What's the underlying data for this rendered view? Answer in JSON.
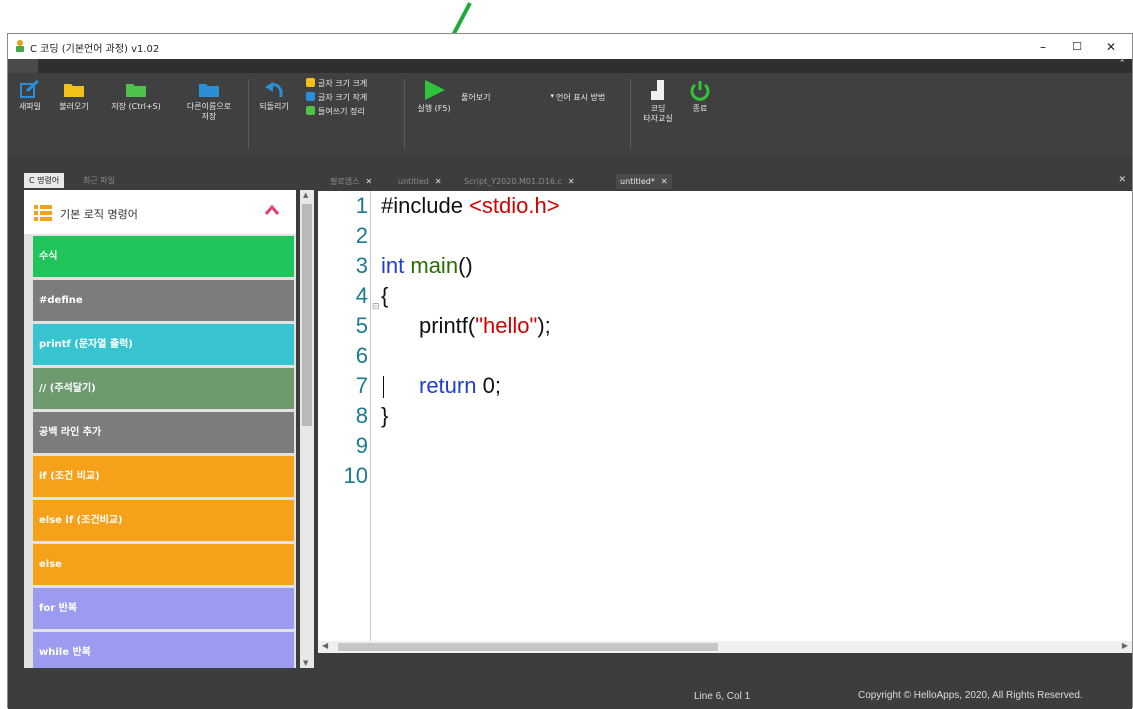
{
  "window": {
    "title": "C 코딩 (기본언어 과정) v1.02"
  },
  "toolbar": {
    "new_file": "새파일",
    "open": "불러오기",
    "save": "저장 (Ctrl+S)",
    "save_as_line1": "다른이름으로",
    "save_as_line2": "저장",
    "undo": "되돌리기",
    "font_bigger": "글자 크기 크게",
    "font_smaller": "글자 크기 작게",
    "indent_cleanup": "들여쓰기 정리",
    "run": "실행 (F5)",
    "view_select": "풀어보기",
    "lang_display": "언어 표시 방법",
    "typing_line1": "코딩",
    "typing_line2": "타자교실",
    "exit": "종료"
  },
  "left_panel": {
    "tabs": [
      "C 명령어",
      "최근 파일"
    ],
    "header": "기본 로직 명령어",
    "items": [
      {
        "label": "수식",
        "color": "#1fc55a"
      },
      {
        "label": "#define",
        "color": "#7c7c7c"
      },
      {
        "label": "printf (문자열 출력)",
        "color": "#38c3d0"
      },
      {
        "label": "// (주석달기)",
        "color": "#6e9a70"
      },
      {
        "label": "공백 라인 추가",
        "color": "#7c7c7c"
      },
      {
        "label": "if (조건 비교)",
        "color": "#f6a11a"
      },
      {
        "label": "else if (조건비교)",
        "color": "#f6a11a"
      },
      {
        "label": "else",
        "color": "#f6a11a"
      },
      {
        "label": "for 반복",
        "color": "#9b9cf0"
      },
      {
        "label": "while 반복",
        "color": "#9b9cf0"
      }
    ]
  },
  "editor": {
    "tabs": [
      {
        "label": "필로앱스",
        "active": false
      },
      {
        "label": "untitled",
        "active": false
      },
      {
        "label": "Script_Y2020.M01.D16.c",
        "active": false
      },
      {
        "label": "untitled*",
        "active": true
      }
    ],
    "line_numbers": [
      "1",
      "2",
      "3",
      "4",
      "5",
      "6",
      "7",
      "8",
      "9",
      "10"
    ],
    "code": {
      "l1_directive": "#include",
      "l1_header": "<stdio.h>",
      "l3_type": "int",
      "l3_func": "main",
      "l3_parens": "()",
      "l4": "{",
      "l5_func": "printf(",
      "l5_str": "\"hello\"",
      "l5_end": ");",
      "l7_kw": "return",
      "l7_val": " 0;",
      "l8": "}"
    }
  },
  "status": {
    "position": "Line 6, Col 1",
    "copyright": "Copyright © HelloApps, 2020, All Rights Reserved."
  },
  "colors": {
    "run_green": "#2fc53a",
    "accent_blue": "#2b8fd8",
    "folder_yellow": "#f2c21b"
  }
}
